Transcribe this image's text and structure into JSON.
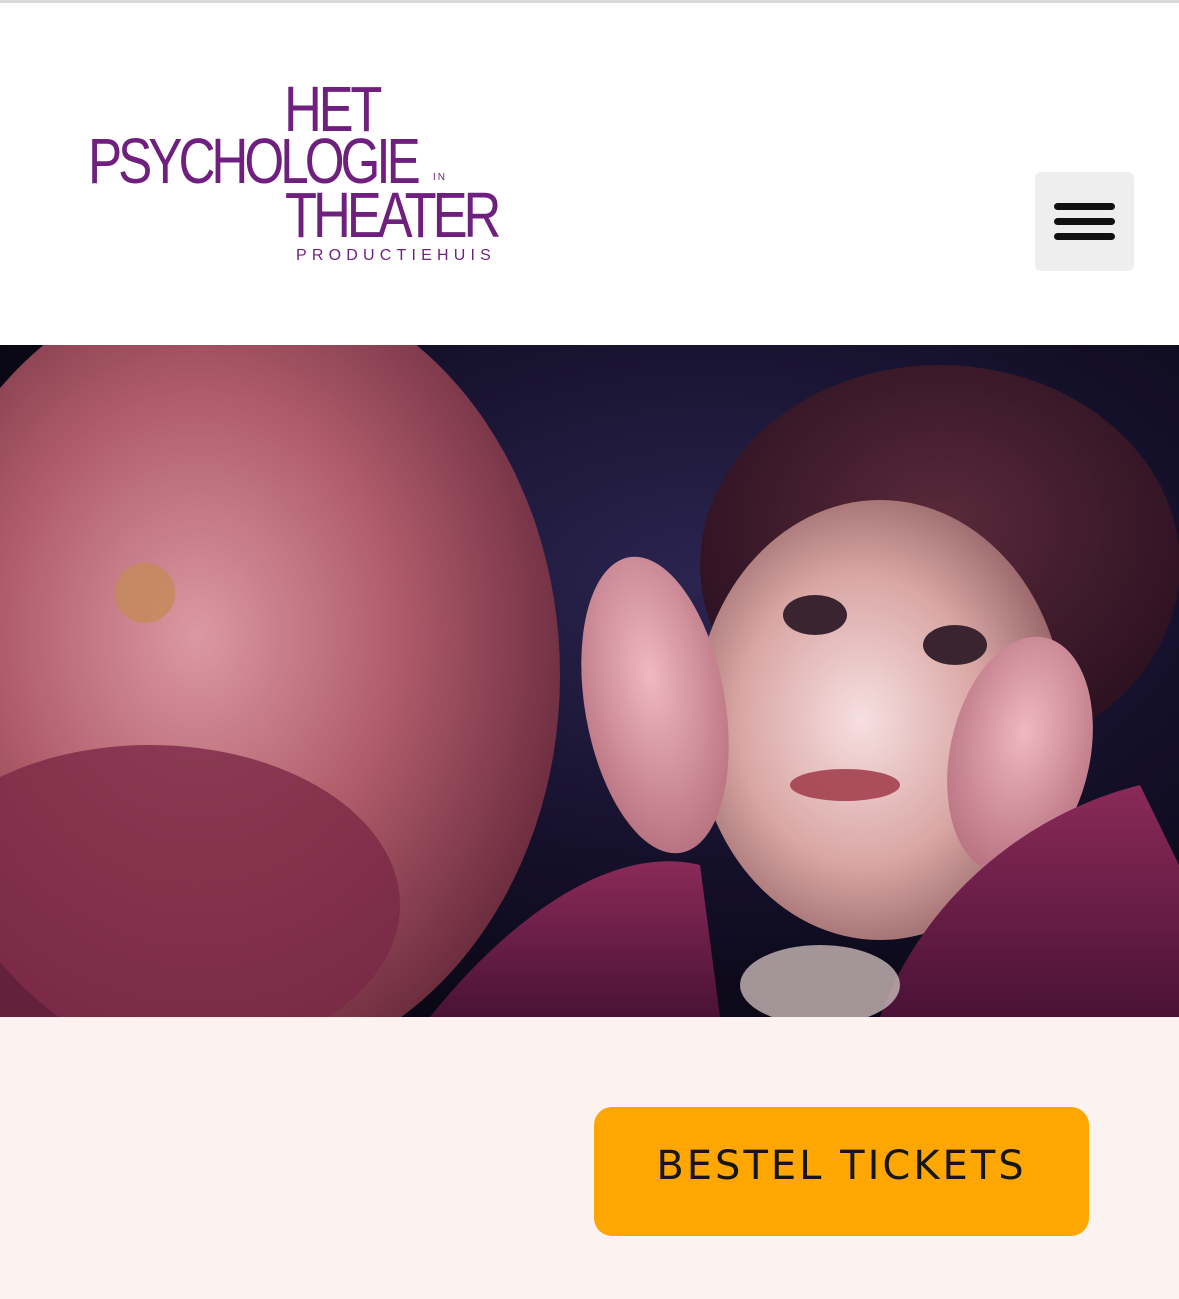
{
  "header": {
    "logo": {
      "line1": "HET",
      "line2": "PSYCHOLOGIE",
      "line2_suffix": "IN",
      "line3": "THEATER",
      "line4": "PRODUCTIEHUIS"
    },
    "menu_icon": "hamburger-menu-icon"
  },
  "hero": {
    "description_icon": "theater-photo"
  },
  "cta": {
    "label": "BESTEL TICKETS"
  },
  "colors": {
    "brand_purple": "#6f1f7e",
    "cta_orange": "#fea601",
    "section_background": "#fcf3f1",
    "menu_button_bg": "#eeeeee"
  }
}
